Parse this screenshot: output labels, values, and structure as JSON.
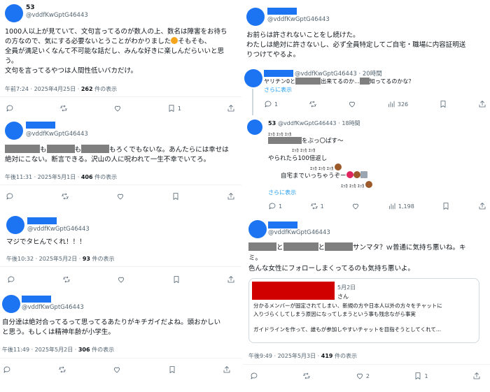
{
  "left": {
    "t1": {
      "name": "53",
      "handle": "@vddfKwGptG46443",
      "lines": [
        "1000人以上が見ていて、文句言ってるのが数人の上、数名は障害をお待ち",
        "の方なので、気にする必要ないとうことがわかりました",
        "全員が満足いくなんて不可能な話だし、みんな好きに楽しんだらいいと思",
        "う。",
        "文句を言ってるやつは人間性低いバカだけ。"
      ],
      "line2_tail": "そもそも、",
      "time": "午前7:24 · 2025年4月25日 · ",
      "views": "262",
      "views_suffix": " 件の表示",
      "bookmark_count": "1"
    },
    "t2": {
      "handle": "@vddfKwGptG46443",
      "line1_parts": [
        "も",
        "も",
        "もろくでもないな。あんたらには幸せは"
      ],
      "line2": "絶対にこない。断言できる。沢山の人に呪われて一生不幸でいてろ。",
      "time": "午後11:31 · 2025年5月1日 · ",
      "views": "406",
      "views_suffix": " 件の表示"
    },
    "t3": {
      "handle": "@vddfKwGptG46443",
      "text": "マジでタヒんでくれ！！！",
      "time": "午後10:32 · 2025年5月2日 · ",
      "views": "93",
      "views_suffix": " 件の表示"
    },
    "t4": {
      "handle": "@vddfKwGptG46443",
      "lines": [
        "自分達は絶対合ってるって思ってるあたりがキチガイだよね。頭おかしい",
        "と思う。もしくは精神年齢が小学生。"
      ],
      "time": "午後11:49 · 2025年5月2日 · ",
      "views": "306",
      "views_suffix": " 件の表示"
    }
  },
  "right": {
    "t5": {
      "handle": "@vddfKwGptG46443",
      "lines": [
        "お前らは許されないことをし続けた。",
        "わたしは絶対に許さないし、必ず全員特定してご自宅・職場に内容証明送",
        "りつけてやるよ。"
      ]
    },
    "t6": {
      "handle": "@vddfKwGptG46443",
      "age": "· 20時間",
      "text_a": "ヤリチン0と",
      "text_b": "出来てるのか...",
      "text_c": "知ってるのかな？",
      "show_more": "さらに表示",
      "reply_count": "1",
      "views": "326"
    },
    "t7": {
      "name": "53",
      "handle": "@vddfKwGptG46443",
      "age": "· 18時間",
      "eq1": "ｴｯｶ ｴｯｶ ｴｯｶ",
      "after_redact": "をぶっ〇ぱす〜",
      "eq2": "ｴｯｶ ｴｯｶ ｴｯｶ",
      "line_return": "やられたら100倍返し",
      "eq3": "ｴｯｶ ｴｯｶ ｴｯｶ",
      "line_home": "自宅までいっちゃうぞー",
      "eq4": "ｴｯｶ ｴｯｶ ｴｯｶ",
      "show_more": "さらに表示",
      "reply_count": "1",
      "retweet_count": "1",
      "views": "1,198"
    },
    "t8": {
      "handle": "@vddfKwGptG46443",
      "line1_mid1": "と",
      "line1_mid2": "と",
      "line1_tail": "サンマタ？ｗ普通に気持ち悪いね。キ",
      "line2": "ミ。",
      "line3": "色んな女性にフォローしまくってるのも気持ち悪いよ。",
      "quote": {
        "date": "5月2日",
        "suffix": "さん",
        "lines": [
          "分かるメンバーが固定されてしまい、新規の方や日本人以外の方々をチャットに",
          "入りづらくしてしまう原因になってしまうという事も残念ながら事実",
          "",
          "ガイドラインを作って、誰もが参加しやすいチャットを目指そうとしてくれて..."
        ]
      },
      "time": "午後9:49 · 2025年5月3日 · ",
      "views": "419",
      "views_suffix": " 件の表示",
      "like_count": "2",
      "bookmark_count": "1"
    }
  },
  "colors": {
    "avatar": "#1d74f2",
    "redaction_gray": "#7f7f7f",
    "redaction_red": "#d00000",
    "link": "#1d9bf0",
    "secondary_text": "#536471"
  },
  "icons": [
    "reply-icon",
    "retweet-icon",
    "like-icon",
    "bookmark-icon",
    "share-icon",
    "views-icon"
  ]
}
